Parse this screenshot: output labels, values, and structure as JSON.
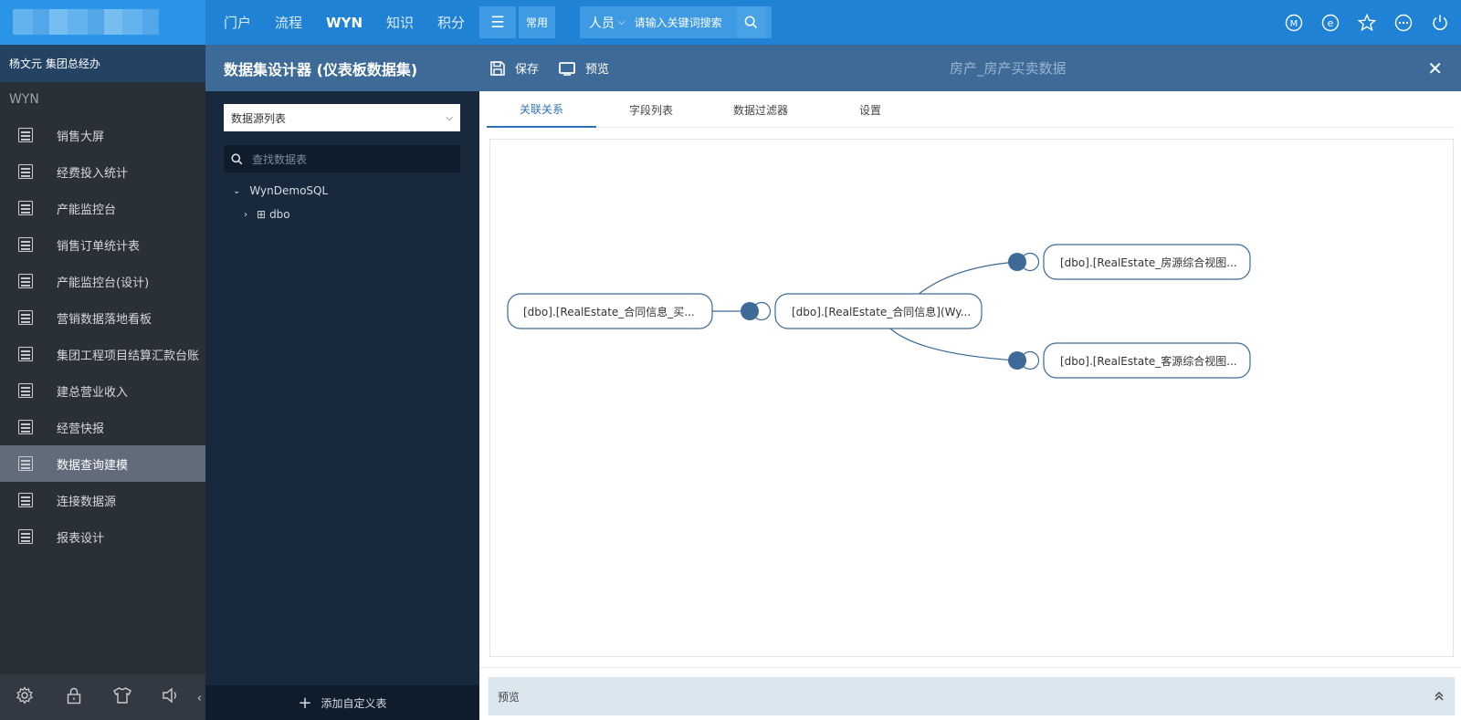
{
  "topnav": {
    "items": [
      "门户",
      "流程",
      "WYN",
      "知识",
      "积分"
    ],
    "active_index": 2,
    "common_label": "常用",
    "search_category": "人员",
    "search_placeholder": "请输入关键词搜索"
  },
  "top_icons": [
    "m-circle-icon",
    "e-circle-icon",
    "star-icon",
    "more-circle-icon",
    "power-icon"
  ],
  "user": {
    "name_role": "杨文元 集团总经办"
  },
  "sidebar": {
    "section_title": "WYN",
    "items": [
      {
        "label": "销售大屏"
      },
      {
        "label": "经费投入统计"
      },
      {
        "label": "产能监控台"
      },
      {
        "label": "销售订单统计表"
      },
      {
        "label": "产能监控台(设计)"
      },
      {
        "label": "营销数据落地看板"
      },
      {
        "label": "集团工程项目结算汇款台账"
      },
      {
        "label": "建总营业收入"
      },
      {
        "label": "经营快报"
      },
      {
        "label": "数据查询建模"
      },
      {
        "label": "连接数据源"
      },
      {
        "label": "报表设计"
      }
    ],
    "active_index": 9,
    "footer_icons": [
      "gear-icon",
      "lock-icon",
      "shirt-icon",
      "speaker-icon"
    ]
  },
  "designer": {
    "title": "数据集设计器 (仪表板数据集)",
    "save_label": "保存",
    "preview_label": "预览",
    "dataset_name": "房产_房产买卖数据"
  },
  "ds_panel": {
    "select_label": "数据源列表",
    "search_placeholder": "查找数据表",
    "tree_root": "WynDemoSQL",
    "tree_child": "dbo",
    "add_custom_table": "添加自定义表"
  },
  "tabs": [
    "关联关系",
    "字段列表",
    "数据过滤器",
    "设置"
  ],
  "active_tab": 0,
  "nodes": {
    "n1": "[dbo].[RealEstate_合同信息_买...",
    "n2": "[dbo].[RealEstate_合同信息](Wy...",
    "n3": "[dbo].[RealEstate_房源综合视图...",
    "n4": "[dbo].[RealEstate_客源综合视图..."
  },
  "preview_bar_label": "预览",
  "colors": {
    "topbar": "#1f82d4",
    "header": "#3d6a96",
    "sidebar": "#293037",
    "accent": "#2d73b4"
  }
}
